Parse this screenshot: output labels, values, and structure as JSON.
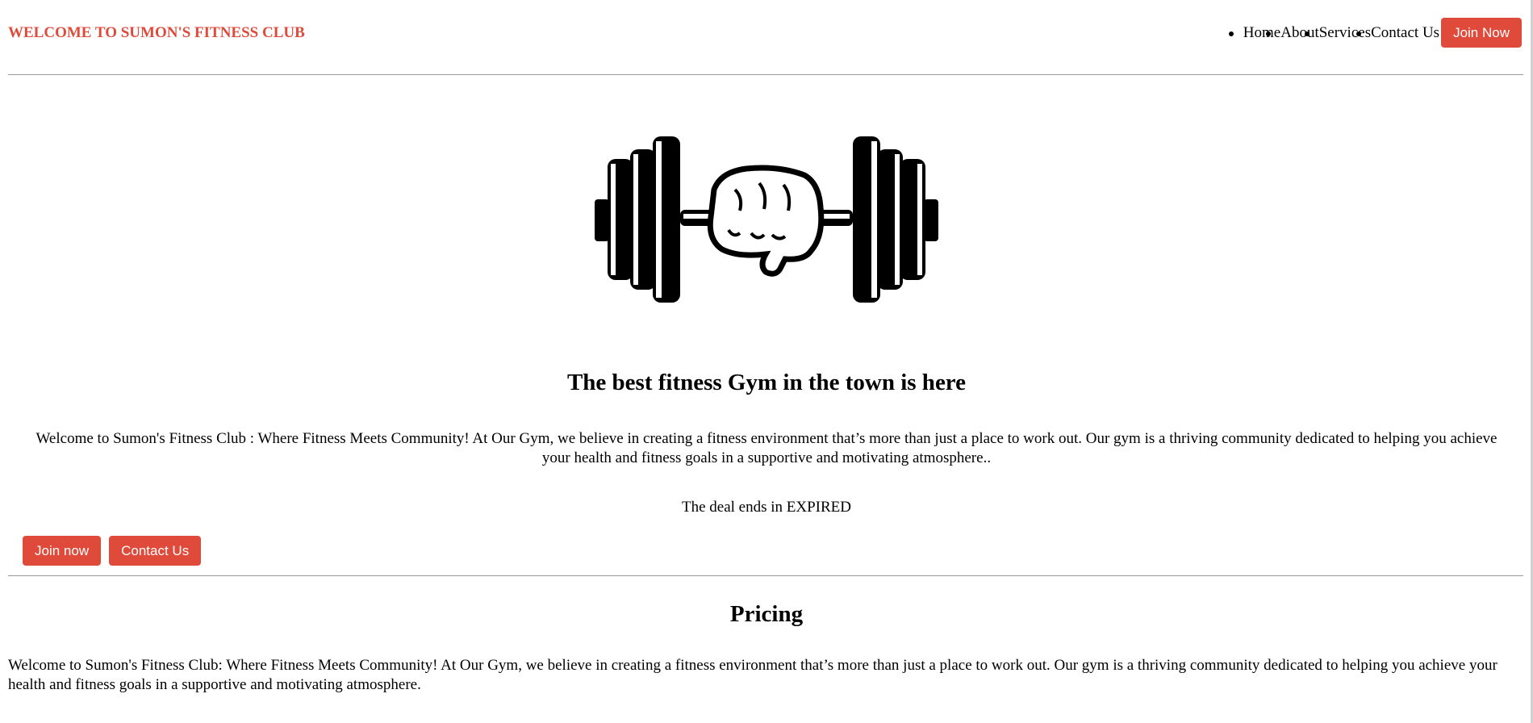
{
  "header": {
    "brand": "WELCOME TO SUMON'S FITNESS CLUB",
    "nav": [
      {
        "label": "Home"
      },
      {
        "label": "About"
      },
      {
        "label": "Services"
      },
      {
        "label": "Contact Us"
      }
    ],
    "join_button": "Join Now"
  },
  "hero": {
    "image_icon": "dumbbell-fist-icon",
    "title": "The best fitness Gym in the town is here",
    "description": "Welcome to Sumon's Fitness Club : Where Fitness Meets Community! At Our Gym, we believe in creating a fitness environment that’s more than just a place to work out. Our gym is a thriving community dedicated to helping you achieve your health and fitness goals in a supportive and motivating atmosphere..",
    "deal_text": "The deal ends in EXPIRED",
    "join_button": "Join now",
    "contact_button": "Contact Us"
  },
  "pricing": {
    "title": "Pricing",
    "description": "Welcome to Sumon's Fitness Club: Where Fitness Meets Community! At Our Gym, we believe in creating a fitness environment that’s more than just a place to work out. Our gym is a thriving community dedicated to helping you achieve your health and fitness goals in a supportive and motivating atmosphere."
  },
  "colors": {
    "accent": "#e04a3a",
    "divider": "#999999"
  }
}
